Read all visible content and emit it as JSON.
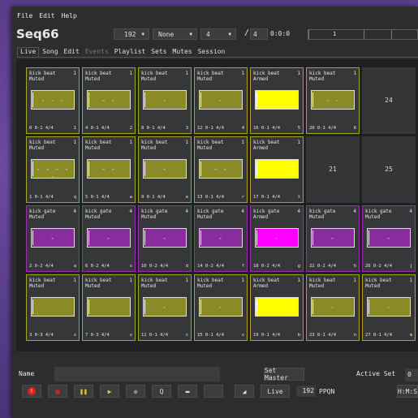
{
  "menu": {
    "file": "File",
    "edit": "Edit",
    "help": "Help"
  },
  "app_title": "Seq66",
  "toolbar": {
    "bpm": "192",
    "key": "None",
    "beats_per_bar": "4",
    "slash": "/",
    "beat_width": "4",
    "clock": "0:0:0",
    "timeline_marker": "1"
  },
  "tabs": [
    "Live",
    "Song",
    "Edit",
    "Events",
    "Playlist",
    "Sets",
    "Mutes",
    "Session"
  ],
  "colors": {
    "yellow_pattern": "#8a8a26",
    "yellow_armed": "#ffff00",
    "purple_pattern": "#8a2c9e",
    "purple_armed": "#ff00ff",
    "accent": "#aaa521"
  },
  "grid": {
    "rows": [
      [
        {
          "name": "kick beat",
          "state": "Muted",
          "ch": "1",
          "foot": "0  0-1 4/4",
          "key": "1",
          "notes": "- - -",
          "color": "yellow",
          "armed": false
        },
        {
          "name": "kick beat",
          "state": "Muted",
          "ch": "1",
          "foot": "4  0-1 4/4",
          "key": "2",
          "notes": "- -",
          "color": "yellow",
          "armed": false
        },
        {
          "name": "kick beat",
          "state": "Muted",
          "ch": "1",
          "foot": "8  0-1 4/4",
          "key": "3",
          "notes": "-",
          "color": "yellow",
          "armed": false
        },
        {
          "name": "kick beat",
          "state": "Muted",
          "ch": "1",
          "foot": "12  0-1 4/4",
          "key": "4",
          "notes": "-",
          "color": "yellow",
          "armed": false
        },
        {
          "name": "kick beat",
          "state": "Armed",
          "ch": "1",
          "foot": "16  0-1 4/4",
          "key": "5",
          "notes": "",
          "color": "yellow",
          "armed": true
        },
        {
          "name": "kick beat",
          "state": "Muted",
          "ch": "1",
          "foot": "20  0-1 4/4",
          "key": "6",
          "notes": "- -",
          "color": "yellow",
          "armed": false
        },
        {
          "empty": true,
          "num": "24"
        }
      ],
      [
        {
          "name": "kick beat",
          "state": "Muted",
          "ch": "1",
          "foot": "1  0-1 4/4",
          "key": "q",
          "notes": "- - - - -",
          "color": "yellow",
          "armed": false
        },
        {
          "name": "kick beat",
          "state": "Muted",
          "ch": "1",
          "foot": "5  0-1 4/4",
          "key": "w",
          "notes": "- -",
          "color": "yellow",
          "armed": false
        },
        {
          "name": "kick beat",
          "state": "Muted",
          "ch": "1",
          "foot": "9  0-1 4/4",
          "key": "e",
          "notes": "-",
          "color": "yellow",
          "armed": false
        },
        {
          "name": "kick beat",
          "state": "Muted",
          "ch": "1",
          "foot": "13  0-1 4/4",
          "key": "r",
          "notes": "- -",
          "color": "yellow",
          "armed": false
        },
        {
          "name": "kick beat",
          "state": "Armed",
          "ch": "1",
          "foot": "17  0-1 4/4",
          "key": "t",
          "notes": "",
          "color": "yellow",
          "armed": true
        },
        {
          "empty": true,
          "num": "21"
        },
        {
          "empty": true,
          "num": "25"
        }
      ],
      [
        {
          "name": "kick gate",
          "state": "Muted",
          "ch": "4",
          "foot": "2  0-2 4/4",
          "key": "a",
          "notes": "-",
          "color": "purple",
          "armed": false
        },
        {
          "name": "kick gate",
          "state": "Muted",
          "ch": "4",
          "foot": "6  0-2 4/4",
          "key": "s",
          "notes": "-",
          "color": "purple",
          "armed": false
        },
        {
          "name": "kick gate",
          "state": "Muted",
          "ch": "4",
          "foot": "10  0-2 4/4",
          "key": "d",
          "notes": "-",
          "color": "purple",
          "armed": false
        },
        {
          "name": "kick gate",
          "state": "Muted",
          "ch": "4",
          "foot": "14  0-2 4/4",
          "key": "f",
          "notes": "-",
          "color": "purple",
          "armed": false
        },
        {
          "name": "kick gate",
          "state": "Armed",
          "ch": "4",
          "foot": "18  0-2 4/4",
          "key": "g",
          "notes": "-",
          "color": "purple",
          "armed": true
        },
        {
          "name": "kick gate",
          "state": "Muted",
          "ch": "4",
          "foot": "22  0-2 4/4",
          "key": "h",
          "notes": "-",
          "color": "purple",
          "armed": false
        },
        {
          "name": "kick gate",
          "state": "Muted",
          "ch": "4",
          "foot": "26  0-2 4/4",
          "key": "j",
          "notes": "-",
          "color": "purple",
          "armed": false
        }
      ],
      [
        {
          "name": "kick beat",
          "state": "Muted",
          "ch": "1",
          "foot": "3  0-3 4/4",
          "key": "z",
          "notes": "",
          "color": "yellow",
          "armed": false
        },
        {
          "name": "kick beat",
          "state": "Muted",
          "ch": "1",
          "foot": "7  0-3 4/4",
          "key": "x",
          "notes": "",
          "color": "yellow",
          "armed": false
        },
        {
          "name": "kick beat",
          "state": "Muted",
          "ch": "1",
          "foot": "11  0-1 4/4",
          "key": "c",
          "notes": "-",
          "color": "yellow",
          "armed": false
        },
        {
          "name": "kick beat",
          "state": "Muted",
          "ch": "1",
          "foot": "15  0-1 4/4",
          "key": "v",
          "notes": "-",
          "color": "yellow",
          "armed": false
        },
        {
          "name": "kick beat",
          "state": "Armed",
          "ch": "1",
          "foot": "19  0-1 4/4",
          "key": "b",
          "notes": "",
          "color": "yellow",
          "armed": true
        },
        {
          "name": "kick beat",
          "state": "Muted",
          "ch": "1",
          "foot": "23  0-1 4/4",
          "key": "n",
          "notes": "-",
          "color": "yellow",
          "armed": false
        },
        {
          "name": "kick beat",
          "state": "Muted",
          "ch": "1",
          "foot": "27  0-1 4/4",
          "key": "m",
          "notes": "-",
          "color": "yellow",
          "armed": false
        }
      ]
    ]
  },
  "bottom": {
    "name_label": "Name",
    "set_master": "Set Master",
    "active_set_label": "Active Set",
    "active_set_value": "0",
    "live_label": "Live",
    "ppqn_value": "192",
    "ppqn_label": "PPQN",
    "time_format": "H:M:S"
  },
  "transport_icons": [
    "panic-icon",
    "stop-icon",
    "pause-icon",
    "play-icon",
    "record-icon",
    "queue-icon",
    "keep-queue-icon",
    "blank",
    "song-record-icon"
  ],
  "transport_glyphs": [
    "!",
    "■",
    "❚❚",
    "▶",
    "●",
    "Q",
    "▬",
    "",
    "◢"
  ]
}
